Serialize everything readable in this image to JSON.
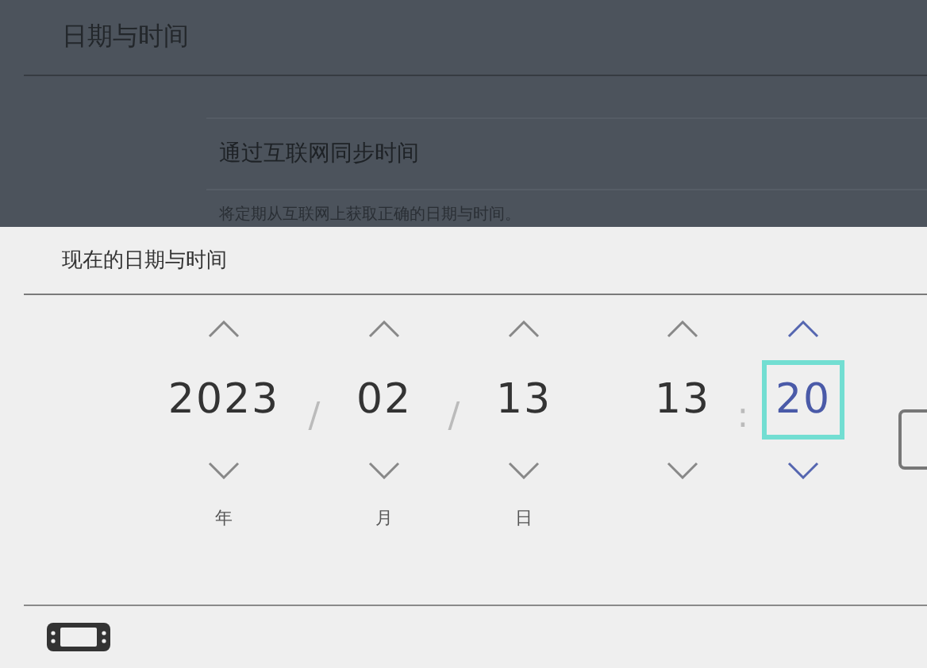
{
  "header": {
    "title": "日期与时间"
  },
  "sync_option": {
    "label": "通过互联网同步时间",
    "description": "将定期从互联网上获取正确的日期与时间。"
  },
  "dialog": {
    "title": "现在的日期与时间",
    "columns": [
      {
        "kind": "field",
        "value": "2023",
        "label": "年",
        "selected": false
      },
      {
        "kind": "separator",
        "text": "/"
      },
      {
        "kind": "field",
        "value": "02",
        "label": "月",
        "selected": false
      },
      {
        "kind": "separator",
        "text": "/"
      },
      {
        "kind": "field",
        "value": "13",
        "label": "日",
        "selected": false
      },
      {
        "kind": "field",
        "value": "13",
        "selected": false
      },
      {
        "kind": "separator",
        "text": ":"
      },
      {
        "kind": "field",
        "value": "20",
        "selected": true
      }
    ]
  }
}
